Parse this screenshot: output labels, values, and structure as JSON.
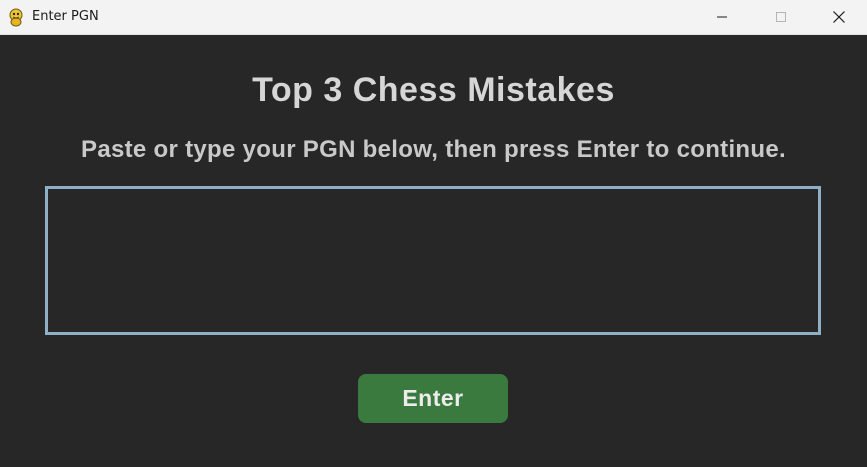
{
  "window": {
    "title": "Enter PGN",
    "app_icon": "pygame-snake-icon",
    "controls": {
      "minimize_icon": "minimize-icon",
      "maximize_icon": "maximize-icon",
      "close_icon": "close-icon"
    }
  },
  "main": {
    "heading": "Top 3 Chess Mistakes",
    "instruction": "Paste or type your PGN below, then press Enter to continue.",
    "pgn_input": {
      "value": "",
      "placeholder": ""
    },
    "enter_button": {
      "label": "Enter"
    }
  },
  "colors": {
    "background": "#272727",
    "text": "#d6d6d6",
    "input_border": "#8fb0c4",
    "button": "#3b7a3e",
    "titlebar": "#f3f3f3"
  }
}
